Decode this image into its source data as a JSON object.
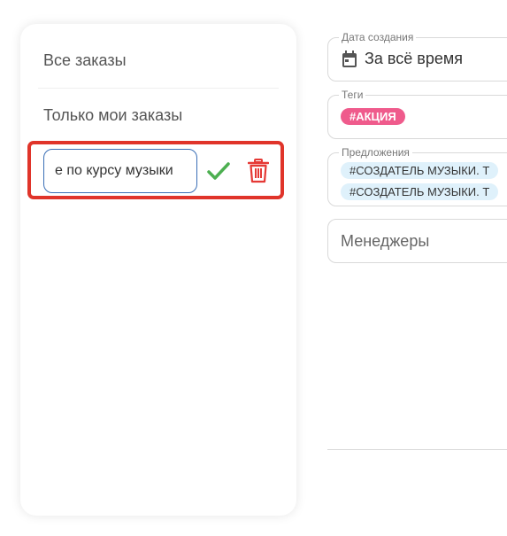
{
  "sidebar": {
    "items": [
      {
        "label": "Все заказы"
      },
      {
        "label": "Только мои заказы"
      }
    ],
    "edit_value": "Заказ по курсу музыки",
    "shown_text": "е по курсу музыки"
  },
  "filters": {
    "date": {
      "legend": "Дата создания",
      "value": "За всё время",
      "icon": "calendar-icon"
    },
    "tags": {
      "legend": "Теги",
      "chip": "#АКЦИЯ",
      "chip_color": "#ef5b8c"
    },
    "offers": {
      "legend": "Предложения",
      "chips": [
        "#СОЗДАТЕЛЬ МУЗЫКИ. Т",
        "#СОЗДАТЕЛЬ МУЗЫКИ. Т"
      ]
    },
    "managers": {
      "placeholder": "Менеджеры"
    }
  },
  "colors": {
    "confirm": "#4caf50",
    "delete": "#e53935",
    "highlight": "#e0342a",
    "input_border": "#3b6fb6"
  }
}
